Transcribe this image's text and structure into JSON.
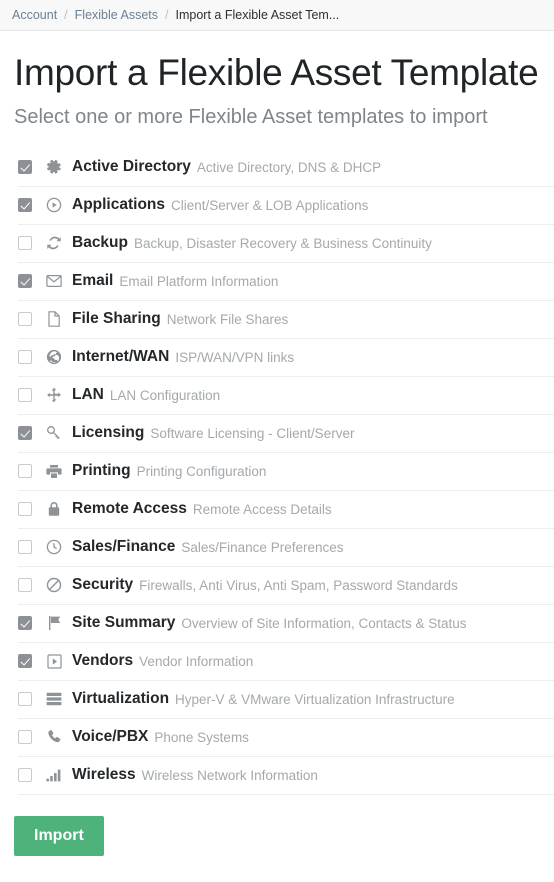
{
  "breadcrumb": {
    "separator": "/",
    "items": [
      {
        "label": "Account",
        "current": false
      },
      {
        "label": "Flexible Assets",
        "current": false
      },
      {
        "label": "Import a Flexible Asset Tem...",
        "current": true
      }
    ]
  },
  "header": {
    "title": "Import a Flexible Asset Template",
    "subtitle": "Select one or more Flexible Asset templates to import"
  },
  "templates": [
    {
      "name": "Active Directory",
      "desc": "Active Directory, DNS & DHCP",
      "icon": "gear-icon",
      "checked": true
    },
    {
      "name": "Applications",
      "desc": "Client/Server & LOB Applications",
      "icon": "play-circle-icon",
      "checked": true
    },
    {
      "name": "Backup",
      "desc": "Backup, Disaster Recovery & Business Continuity",
      "icon": "refresh-icon",
      "checked": false
    },
    {
      "name": "Email",
      "desc": "Email Platform Information",
      "icon": "envelope-icon",
      "checked": true
    },
    {
      "name": "File Sharing",
      "desc": "Network File Shares",
      "icon": "document-icon",
      "checked": false
    },
    {
      "name": "Internet/WAN",
      "desc": "ISP/WAN/VPN links",
      "icon": "globe-icon",
      "checked": false
    },
    {
      "name": "LAN",
      "desc": "LAN Configuration",
      "icon": "move-arrows-icon",
      "checked": false
    },
    {
      "name": "Licensing",
      "desc": "Software Licensing - Client/Server",
      "icon": "key-icon",
      "checked": true
    },
    {
      "name": "Printing",
      "desc": "Printing Configuration",
      "icon": "printer-icon",
      "checked": false
    },
    {
      "name": "Remote Access",
      "desc": "Remote Access Details",
      "icon": "lock-icon",
      "checked": false
    },
    {
      "name": "Sales/Finance",
      "desc": "Sales/Finance Preferences",
      "icon": "clock-icon",
      "checked": false
    },
    {
      "name": "Security",
      "desc": "Firewalls, Anti Virus, Anti Spam, Password Standards",
      "icon": "ban-icon",
      "checked": false
    },
    {
      "name": "Site Summary",
      "desc": "Overview of Site Information, Contacts & Status",
      "icon": "flag-icon",
      "checked": true
    },
    {
      "name": "Vendors",
      "desc": "Vendor Information",
      "icon": "play-square-icon",
      "checked": true
    },
    {
      "name": "Virtualization",
      "desc": "Hyper-V & VMware Virtualization Infrastructure",
      "icon": "server-stack-icon",
      "checked": false
    },
    {
      "name": "Voice/PBX",
      "desc": "Phone Systems",
      "icon": "phone-icon",
      "checked": false
    },
    {
      "name": "Wireless",
      "desc": "Wireless Network Information",
      "icon": "signal-bars-icon",
      "checked": false
    }
  ],
  "actions": {
    "import_label": "Import"
  },
  "colors": {
    "accent_green": "#4db37b",
    "checkbox_checked": "#8d9196",
    "name_text": "#24282b",
    "desc_text": "#a3a9ad",
    "breadcrumb_bg": "#f8f8f9",
    "breadcrumb_link": "#6d7f90"
  }
}
